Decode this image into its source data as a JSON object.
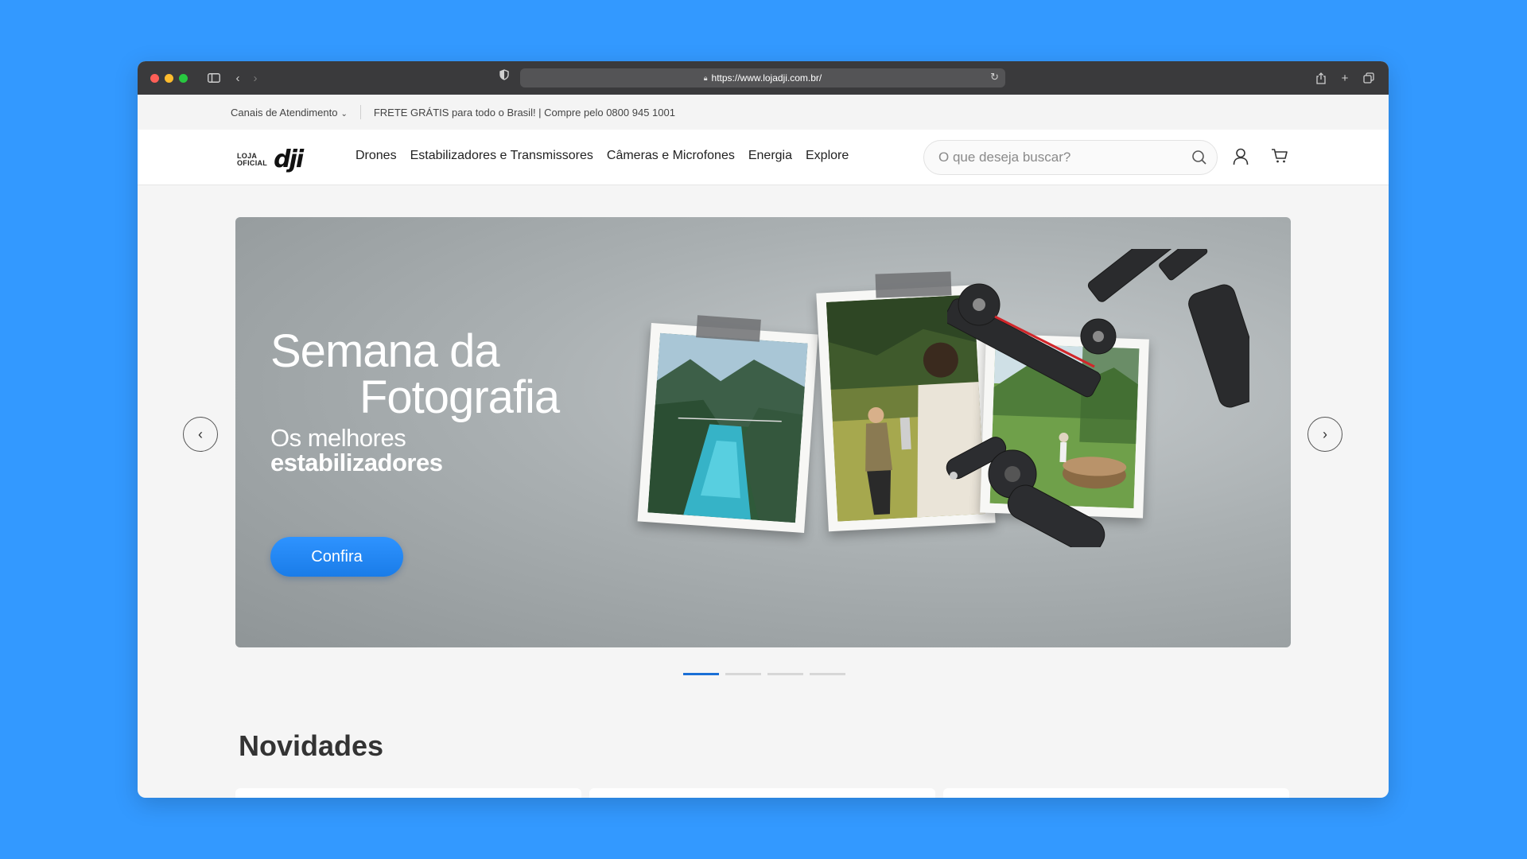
{
  "browser": {
    "url": "https://www.lojadji.com.br/",
    "traffic_colors": [
      "#ff5f57",
      "#febc2e",
      "#28c840"
    ]
  },
  "topbar": {
    "channels_label": "Canais de Atendimento",
    "promo_text": "FRETE GRÁTIS para todo o Brasil! | Compre pelo 0800 945 1001"
  },
  "header": {
    "logo_small_line1": "LOJA",
    "logo_small_line2": "OFICIAL",
    "logo_brand": "dji",
    "nav": [
      "Drones",
      "Estabilizadores e Transmissores",
      "Câmeras e Microfones",
      "Energia",
      "Explore"
    ],
    "search_placeholder": "O que deseja buscar?"
  },
  "hero": {
    "line1": "Semana da",
    "line2": "Fotografia",
    "line3": "Os melhores",
    "line4": "estabilizadores",
    "cta_label": "Confira",
    "slide_count": 4,
    "active_slide": 1
  },
  "section": {
    "title": "Novidades"
  },
  "colors": {
    "accent": "#1a7ce8",
    "page_bg": "#3399ff",
    "active_indicator": "#1a6fd6"
  }
}
